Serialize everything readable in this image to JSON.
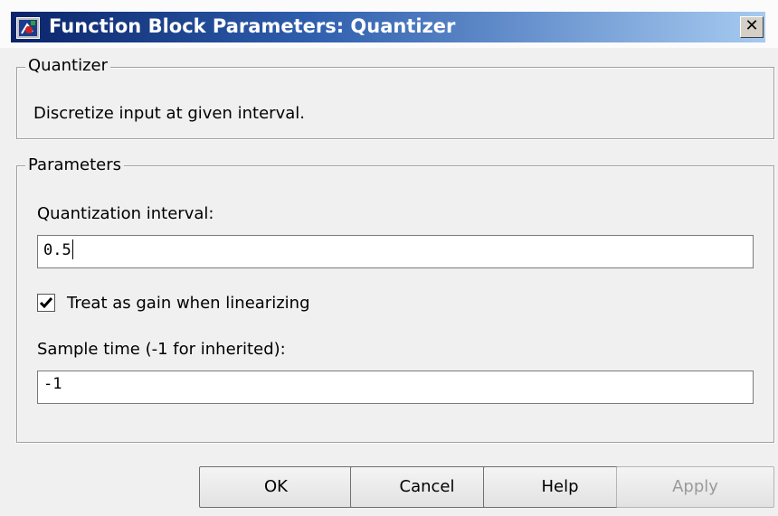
{
  "window": {
    "title": "Function Block Parameters: Quantizer",
    "close_glyph": "✕",
    "icon": "simulink-block-icon"
  },
  "block_group": {
    "legend": "Quantizer",
    "description": "Discretize input at given interval."
  },
  "parameters_group": {
    "legend": "Parameters",
    "quantization_interval": {
      "label": "Quantization interval:",
      "value": "0.5"
    },
    "treat_as_gain": {
      "label": "Treat as gain when linearizing",
      "checked": true
    },
    "sample_time": {
      "label": "Sample time (-1 for inherited):",
      "value": "-1"
    }
  },
  "buttons": {
    "ok": "OK",
    "cancel": "Cancel",
    "help": "Help",
    "apply": "Apply"
  }
}
